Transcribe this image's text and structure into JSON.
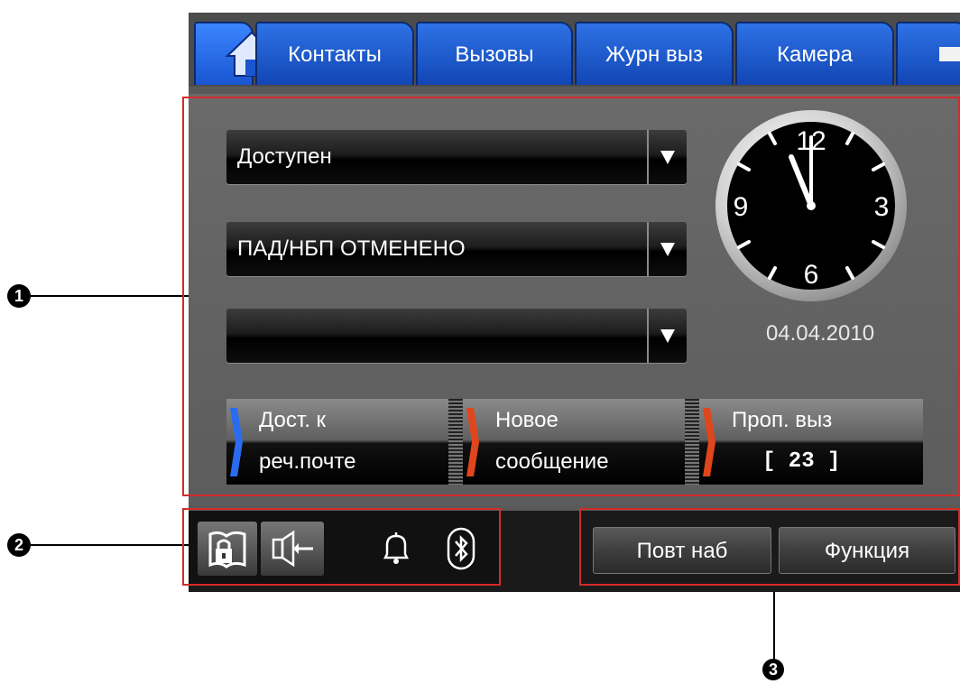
{
  "tabs": [
    {
      "id": "home",
      "label": "",
      "icon": "home-icon"
    },
    {
      "id": "contacts",
      "label": "Контакты"
    },
    {
      "id": "calls",
      "label": "Вызовы"
    },
    {
      "id": "call_log",
      "label": "Журн выз"
    },
    {
      "id": "camera",
      "label": "Камера"
    },
    {
      "id": "next",
      "label": "",
      "icon": "arrow-right-icon"
    }
  ],
  "main": {
    "dropdowns": [
      {
        "value": "Доступен"
      },
      {
        "value": "ПАД/НБП ОТМЕНЕНО"
      },
      {
        "value": ""
      }
    ],
    "clock": {
      "numerals": [
        "12",
        "3",
        "6",
        "9"
      ],
      "time": "11:59"
    },
    "date": "04.04.2010",
    "status_buttons": [
      {
        "line1": "Дост. к",
        "line2": "реч.почте",
        "marker_color": "#2a6cf0"
      },
      {
        "line1": "Новое",
        "line2": "сообщение",
        "marker_color": "#e0461c"
      },
      {
        "line1": "Проп. выз",
        "line2": "[ 23 ]",
        "marker_color": "#e0461c"
      }
    ]
  },
  "bottom": {
    "icons": [
      {
        "name": "phonebook-lock-icon"
      },
      {
        "name": "speaker-icon"
      },
      {
        "name": "bell-icon"
      },
      {
        "name": "bluetooth-icon"
      }
    ],
    "function_keys": [
      {
        "label": "Повт наб"
      },
      {
        "label": "Функция"
      }
    ]
  },
  "callouts": [
    "1",
    "2",
    "3"
  ],
  "colors": {
    "tab_blue": "#1f5ad6",
    "highlight_red": "#d42b2b",
    "marker_blue": "#2a6cf0",
    "marker_orange": "#e0461c"
  }
}
